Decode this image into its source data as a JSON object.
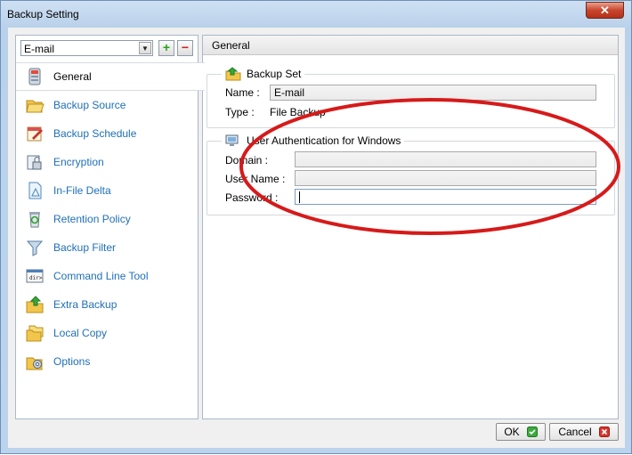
{
  "window": {
    "title": "Backup Setting",
    "close_glyph": "✕"
  },
  "backup_set_selector": {
    "selected": "E-mail",
    "add_glyph": "+",
    "remove_glyph": "−"
  },
  "sidebar": {
    "items": [
      {
        "label": "General",
        "icon": "general-icon",
        "selected": true
      },
      {
        "label": "Backup Source",
        "icon": "folder-open-icon"
      },
      {
        "label": "Backup Schedule",
        "icon": "schedule-icon"
      },
      {
        "label": "Encryption",
        "icon": "encryption-icon"
      },
      {
        "label": "In-File Delta",
        "icon": "document-delta-icon"
      },
      {
        "label": "Retention Policy",
        "icon": "recycle-icon"
      },
      {
        "label": "Backup Filter",
        "icon": "funnel-icon"
      },
      {
        "label": "Command Line Tool",
        "icon": "command-line-icon"
      },
      {
        "label": "Extra Backup",
        "icon": "folder-arrow-icon"
      },
      {
        "label": "Local Copy",
        "icon": "folder-copy-icon"
      },
      {
        "label": "Options",
        "icon": "options-gear-icon"
      }
    ]
  },
  "main": {
    "header": "General",
    "backup_set": {
      "legend": "Backup Set",
      "name_label": "Name :",
      "name_value": "E-mail",
      "type_label": "Type :",
      "type_value": "File Backup"
    },
    "user_auth": {
      "legend": "User Authentication for Windows",
      "domain_label": "Domain :",
      "domain_value": "",
      "username_label": "User Name :",
      "username_value": "",
      "password_label": "Password :",
      "password_value": ""
    }
  },
  "footer": {
    "ok_label": "OK",
    "cancel_label": "Cancel"
  },
  "colors": {
    "nav_link": "#1f6fb7",
    "annotation_ellipse": "#d61a1a",
    "ok_check": "#2f9e2f",
    "cancel_x": "#d21f1f"
  }
}
